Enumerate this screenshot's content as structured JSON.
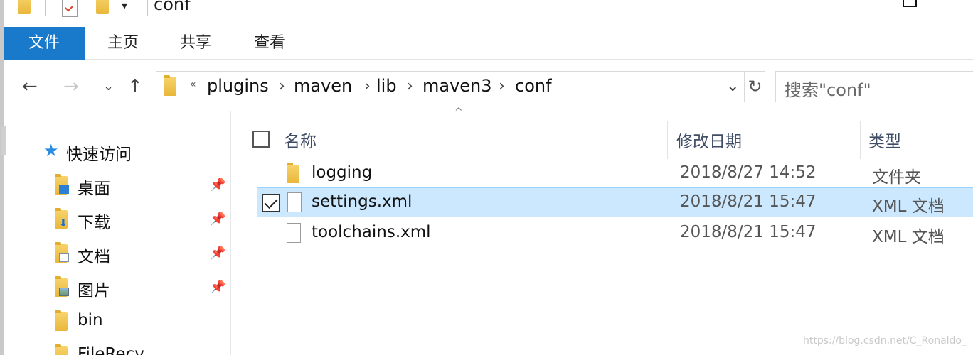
{
  "window": {
    "title": "conf"
  },
  "ribbon": {
    "tabs": [
      "文件",
      "主页",
      "共享",
      "查看"
    ]
  },
  "nav": {
    "back": "←",
    "forward": "→",
    "recent": "⌄",
    "up": "↑"
  },
  "address": {
    "overflow": "«",
    "crumbs": [
      "plugins",
      "maven",
      "lib",
      "maven3",
      "conf"
    ],
    "separator": "›",
    "dropdown": "⌄",
    "refresh": "↻"
  },
  "search": {
    "placeholder": "搜索\"conf\""
  },
  "navpane": {
    "quick_access": "快速访问",
    "items": [
      {
        "label": "桌面",
        "pinned": true,
        "icon": "desktop-folder-icon"
      },
      {
        "label": "下载",
        "pinned": true,
        "icon": "downloads-folder-icon"
      },
      {
        "label": "文档",
        "pinned": true,
        "icon": "documents-folder-icon"
      },
      {
        "label": "图片",
        "pinned": true,
        "icon": "pictures-folder-icon"
      },
      {
        "label": "bin",
        "pinned": false,
        "icon": "folder-icon"
      },
      {
        "label": "FileRecv",
        "pinned": false,
        "icon": "folder-icon"
      }
    ],
    "pin_glyph": "📌"
  },
  "columns": {
    "name": "名称",
    "modified": "修改日期",
    "type": "类型",
    "sort_glyph": "^"
  },
  "files": [
    {
      "name": "logging",
      "modified": "2018/8/27 14:52",
      "type": "文件夹",
      "kind": "folder",
      "selected": false
    },
    {
      "name": "settings.xml",
      "modified": "2018/8/21 15:47",
      "type": "XML 文档",
      "kind": "document",
      "selected": true
    },
    {
      "name": "toolchains.xml",
      "modified": "2018/8/21 15:47",
      "type": "XML 文档",
      "kind": "document",
      "selected": false
    }
  ],
  "watermark": "https://blog.csdn.net/C_Ronaldo_",
  "colors": {
    "accent": "#1979ca",
    "selection": "#cce8ff",
    "folder": "#f0c44c"
  }
}
